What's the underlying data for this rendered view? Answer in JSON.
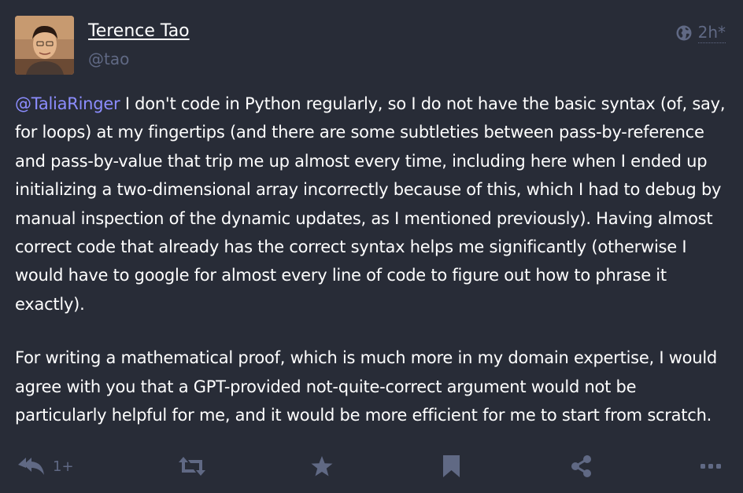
{
  "author": {
    "display_name": "Terence Tao",
    "handle": "@tao"
  },
  "meta": {
    "visibility_icon": "globe-icon",
    "relative_time": "2h",
    "edited_marker": "*"
  },
  "content": {
    "mention": "@TaliaRinger",
    "paragraph_1_rest": " I don't code in Python regularly, so I do not have the basic syntax (of, say, for loops) at my fingertips (and there are some subtleties between pass-by-reference and pass-by-value that trip me up almost every time, including here when I ended up initializing a two-dimensional array incorrectly because of this, which I had to debug by manual inspection of the dynamic updates, as I mentioned previously). Having almost correct code that already has the correct syntax helps me significantly (otherwise I would have to google for almost every line of code to figure out how to phrase it exactly).",
    "paragraph_2": "For writing a mathematical proof, which is much more in my domain expertise, I would agree with you that a GPT-provided not-quite-correct argument would not be particularly helpful for me, and it would be more efficient for me to start from scratch."
  },
  "actions": {
    "reply_icon": "reply-all-icon",
    "reply_count": "1+",
    "boost_icon": "retweet-icon",
    "favourite_icon": "star-icon",
    "bookmark_icon": "bookmark-icon",
    "share_icon": "share-icon",
    "more_icon": "ellipsis-icon"
  },
  "colors": {
    "background": "#282c37",
    "text": "#ffffff",
    "muted": "#606984",
    "mention": "#8c8dff"
  }
}
